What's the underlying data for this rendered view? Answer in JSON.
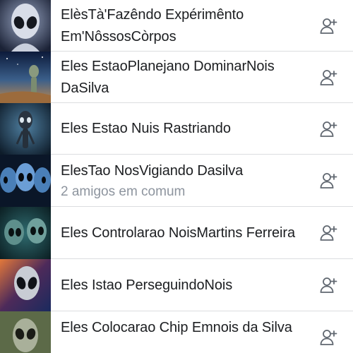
{
  "suggestions": [
    {
      "name": "ElèsTà'Fazêndo Expérimênto Em'NôssosCòrpos",
      "mutual": "",
      "thumb": "alien-gray-bright"
    },
    {
      "name": "Eles EstaoPlanejano DominarNois DaSilva",
      "mutual": "",
      "thumb": "alien-desert-sky"
    },
    {
      "name": "Eles Estao Nuis Rastriando",
      "mutual": "",
      "thumb": "alien-dark-blue"
    },
    {
      "name": "ElesTao NosVigiando Dasilva",
      "mutual": "2 amigos em comum",
      "thumb": "alien-group-blue"
    },
    {
      "name": "Eles Controlarao NoisMartins Ferreira",
      "mutual": "",
      "thumb": "alien-teal-duo"
    },
    {
      "name": "Eles Istao PerseguindoNois",
      "mutual": "",
      "thumb": "alien-space-orange"
    },
    {
      "name": "Eles Colocarao Chip Emnois da Silva",
      "mutual": "",
      "thumb": "alien-green-gray"
    }
  ],
  "icons": {
    "add_friend": "add-friend-icon"
  },
  "colors": {
    "divider": "#dcdde0",
    "secondary_text": "#8d949e",
    "icon": "#606770"
  }
}
